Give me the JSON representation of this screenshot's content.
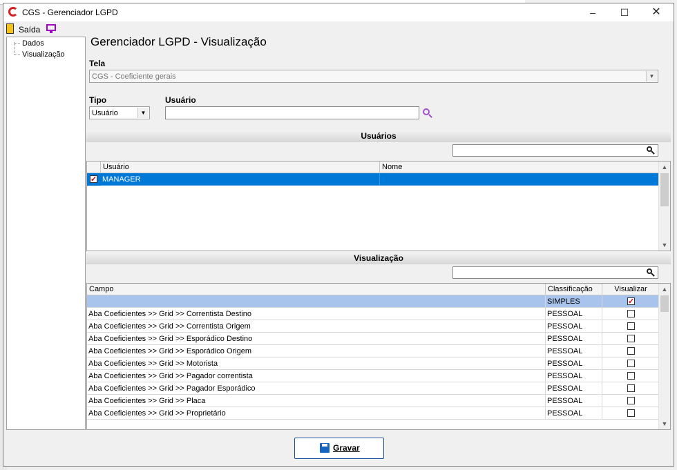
{
  "window": {
    "title": "CGS - Gerenciador LGPD"
  },
  "toolbar": {
    "exit_label": "Saída"
  },
  "tree": {
    "items": [
      "Dados",
      "Visualização"
    ]
  },
  "page": {
    "heading": "Gerenciador LGPD - Visualização"
  },
  "form": {
    "tela_label": "Tela",
    "tela_value": "CGS - Coeficiente gerais",
    "tipo_label": "Tipo",
    "tipo_value": "Usuário",
    "usuario_label": "Usuário",
    "usuario_value": ""
  },
  "users": {
    "section_title": "Usuários",
    "search_value": "",
    "columns": [
      "Usuário",
      "Nome"
    ],
    "rows": [
      {
        "usuario": "MANAGER",
        "nome": "",
        "checked": true
      }
    ]
  },
  "visualization": {
    "section_title": "Visualização",
    "search_value": "",
    "columns": [
      "Campo",
      "Classificação",
      "Visualizar"
    ],
    "rows": [
      {
        "campo": "",
        "classificacao": "SIMPLES",
        "visualizar": true
      },
      {
        "campo": "Aba Coeficientes >> Grid >> Correntista Destino",
        "classificacao": "PESSOAL",
        "visualizar": false
      },
      {
        "campo": "Aba Coeficientes >> Grid >> Correntista Origem",
        "classificacao": "PESSOAL",
        "visualizar": false
      },
      {
        "campo": "Aba Coeficientes >> Grid >> Esporádico Destino",
        "classificacao": "PESSOAL",
        "visualizar": false
      },
      {
        "campo": "Aba Coeficientes >> Grid >> Esporádico Origem",
        "classificacao": "PESSOAL",
        "visualizar": false
      },
      {
        "campo": "Aba Coeficientes >> Grid >> Motorista",
        "classificacao": "PESSOAL",
        "visualizar": false
      },
      {
        "campo": "Aba Coeficientes >> Grid >> Pagador correntista",
        "classificacao": "PESSOAL",
        "visualizar": false
      },
      {
        "campo": "Aba Coeficientes >> Grid >> Pagador Esporádico",
        "classificacao": "PESSOAL",
        "visualizar": false
      },
      {
        "campo": "Aba Coeficientes >> Grid >> Placa",
        "classificacao": "PESSOAL",
        "visualizar": false
      },
      {
        "campo": "Aba Coeficientes >> Grid >> Proprietário",
        "classificacao": "PESSOAL",
        "visualizar": false
      }
    ]
  },
  "footer": {
    "save_label": "Gravar"
  },
  "colors": {
    "selection": "#0078d7",
    "row_highlight": "#a8c4ec",
    "accent_icon": "#a000c8",
    "brand_red": "#d42020"
  }
}
